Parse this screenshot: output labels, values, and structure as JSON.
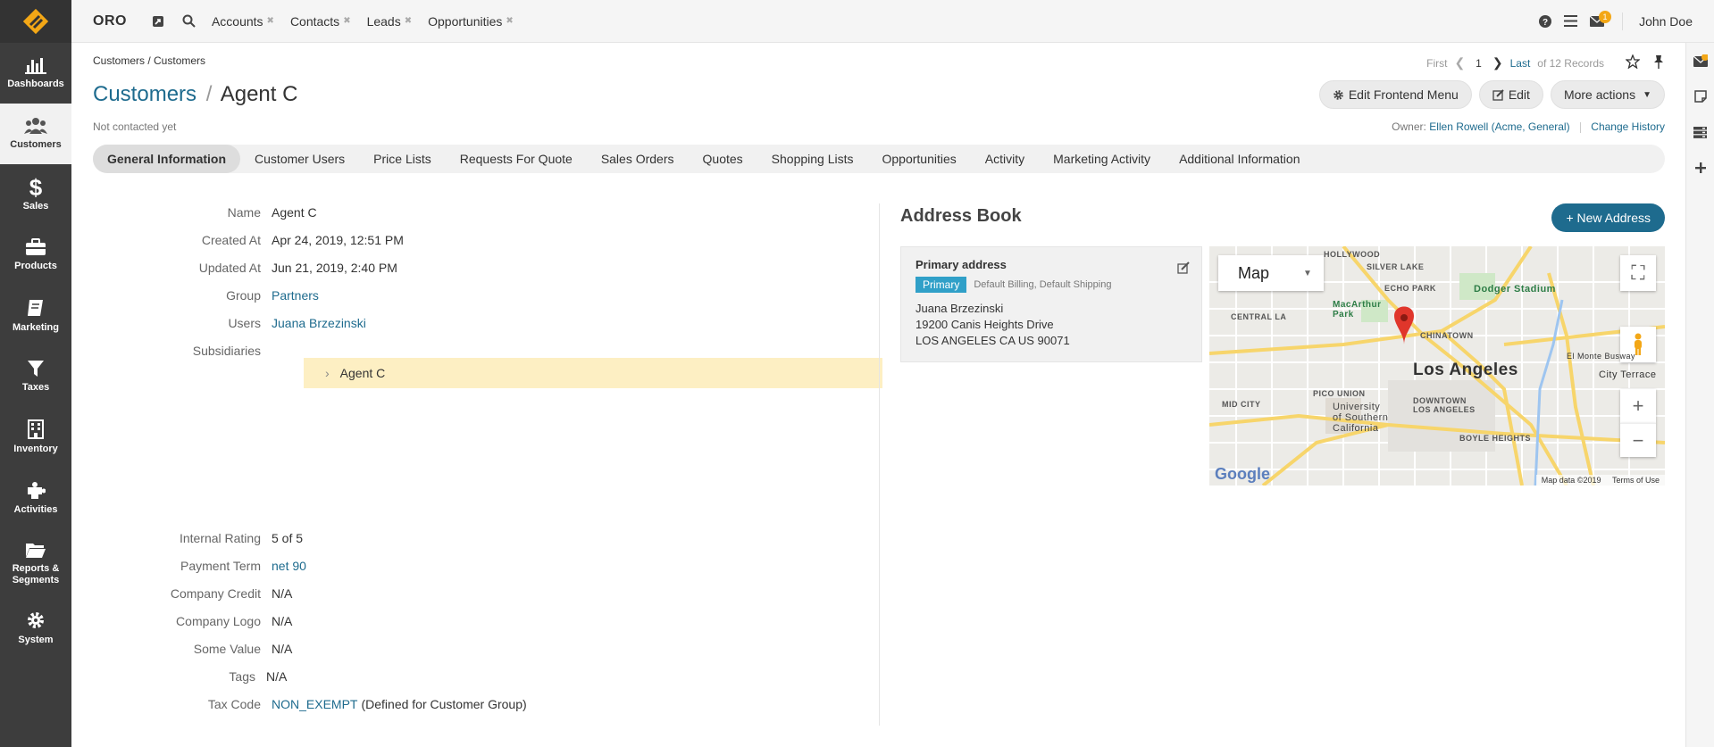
{
  "topbar": {
    "brand": "ORO",
    "pins": [
      "Accounts",
      "Contacts",
      "Leads",
      "Opportunities"
    ],
    "notification_count": "1",
    "user": "John Doe"
  },
  "sidebar": {
    "items": [
      {
        "label": "Dashboards",
        "icon": "dashboard-icon"
      },
      {
        "label": "Customers",
        "icon": "customers-icon"
      },
      {
        "label": "Sales",
        "icon": "dollar-icon"
      },
      {
        "label": "Products",
        "icon": "briefcase-icon"
      },
      {
        "label": "Marketing",
        "icon": "book-icon"
      },
      {
        "label": "Taxes",
        "icon": "filter-icon"
      },
      {
        "label": "Inventory",
        "icon": "building-icon"
      },
      {
        "label": "Activities",
        "icon": "puzzle-icon"
      },
      {
        "label": "Reports &",
        "label2": "Segments",
        "icon": "folder-icon"
      },
      {
        "label": "System",
        "icon": "gear-icon"
      }
    ]
  },
  "page": {
    "breadcrumb": "Customers / Customers",
    "pager": {
      "first": "First",
      "current": "1",
      "last": "Last",
      "total": "of 12 Records"
    },
    "title_link": "Customers",
    "title_sep": "/",
    "title": "Agent C",
    "subtitle": "Not contacted yet",
    "owner_label": "Owner:",
    "owner": "Ellen Rowell (Acme, General)",
    "change_history": "Change History",
    "buttons": {
      "edit_frontend_menu": "Edit Frontend Menu",
      "edit": "Edit",
      "more_actions": "More actions"
    }
  },
  "tabs": [
    "General Information",
    "Customer Users",
    "Price Lists",
    "Requests For Quote",
    "Sales Orders",
    "Quotes",
    "Shopping Lists",
    "Opportunities",
    "Activity",
    "Marketing Activity",
    "Additional Information"
  ],
  "info": {
    "name": {
      "label": "Name",
      "value": "Agent C"
    },
    "created": {
      "label": "Created At",
      "value": "Apr 24, 2019, 12:51 PM"
    },
    "updated": {
      "label": "Updated At",
      "value": "Jun 21, 2019, 2:40 PM"
    },
    "group": {
      "label": "Group",
      "value": "Partners"
    },
    "users": {
      "label": "Users",
      "value": "Juana Brzezinski"
    },
    "subsidiaries": {
      "label": "Subsidiaries",
      "tree_item": "Agent C"
    },
    "rating": {
      "label": "Internal Rating",
      "value": "5 of 5"
    },
    "payment": {
      "label": "Payment Term",
      "value": "net 90"
    },
    "credit": {
      "label": "Company Credit",
      "value": "N/A"
    },
    "logo": {
      "label": "Company Logo",
      "value": "N/A"
    },
    "some": {
      "label": "Some Value",
      "value": "N/A"
    },
    "tags": {
      "label": "Tags",
      "value": "N/A"
    },
    "taxcode": {
      "label": "Tax Code",
      "value": "NON_EXEMPT",
      "note": "(Defined for Customer Group)"
    }
  },
  "address_book": {
    "title": "Address Book",
    "new_button": "+ New Address",
    "card": {
      "title": "Primary address",
      "badge": "Primary",
      "types": "Default Billing, Default Shipping",
      "name": "Juana Brzezinski",
      "street": "19200 Canis Heights Drive",
      "city": "LOS ANGELES CA US 90071"
    },
    "map": {
      "type": "Map",
      "city": "Los Angeles",
      "labels": [
        "HOLLYWOOD",
        "SILVER LAKE",
        "ECHO PARK",
        "Dodger Stadium",
        "CENTRAL LA",
        "MacArthur Park",
        "CHINATOWN",
        "PICO UNION",
        "MID CITY",
        "University of Southern California",
        "DOWNTOWN LOS ANGELES",
        "BOYLE HEIGHTS",
        "City Terrace",
        "El Monte Busway"
      ],
      "footer": "Map data ©2019",
      "terms": "Terms of Use",
      "google": "Google"
    }
  }
}
